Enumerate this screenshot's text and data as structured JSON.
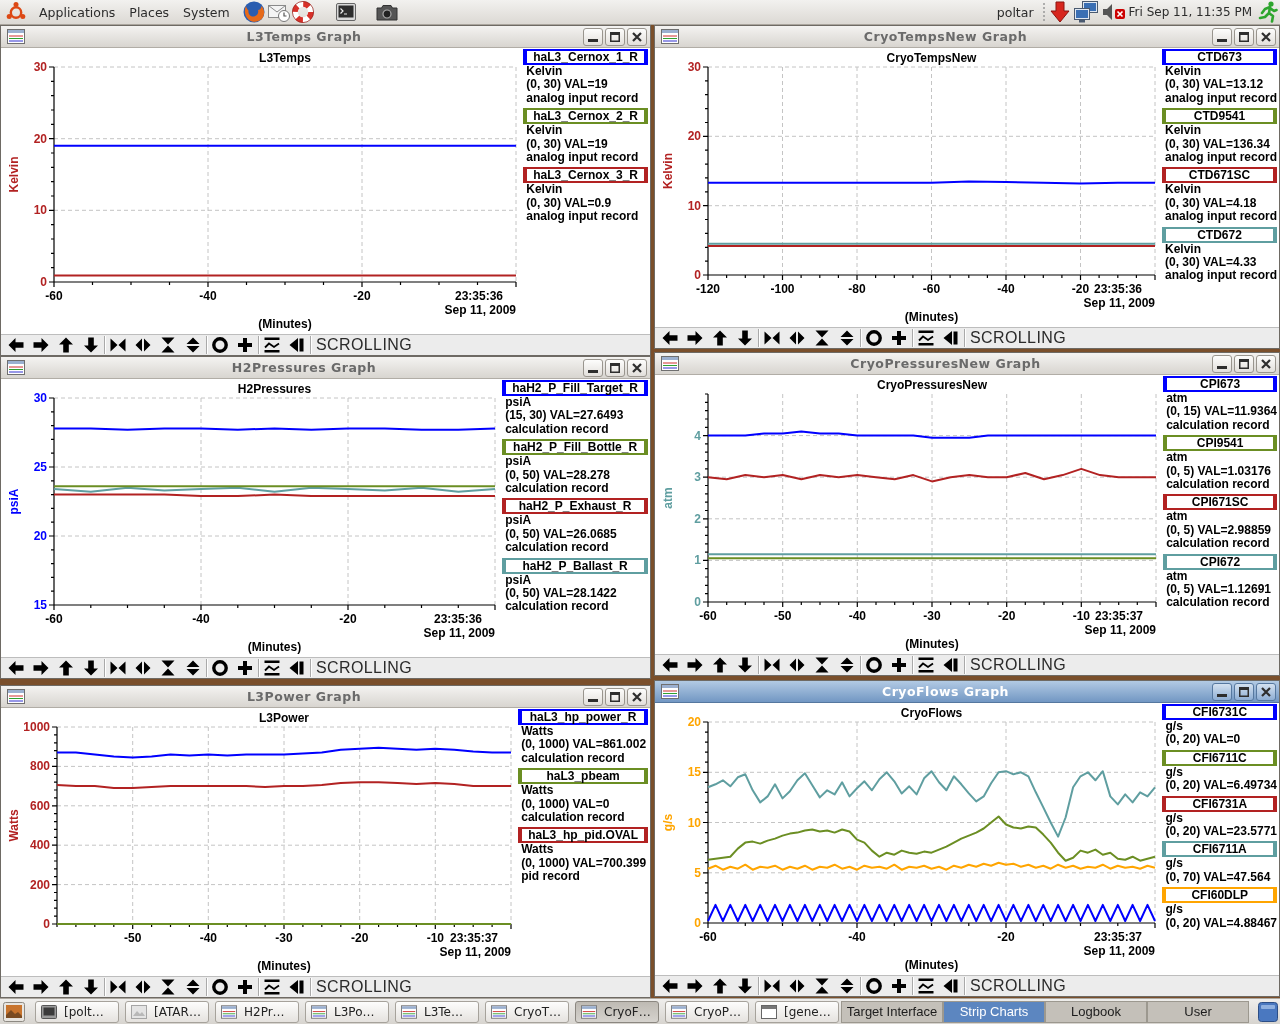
{
  "top_panel": {
    "menus": [
      "Applications",
      "Places",
      "System"
    ],
    "user": "poltar",
    "clock": "Fri Sep 11, 11:35 PM"
  },
  "windows": [
    {
      "title": "L3Temps Graph",
      "active": false,
      "graph": {
        "chart_data": {
          "type": "line",
          "title": "L3Temps",
          "xlabel": "(Minutes)",
          "ylabel": "Kelvin",
          "x": [
            -60,
            -50,
            -40,
            -30,
            -20,
            -10,
            0
          ],
          "series": [
            {
              "color": "#0000ff",
              "values": [
                19,
                19,
                19,
                19,
                19,
                19,
                19
              ]
            },
            {
              "color": "#b22222",
              "values": [
                0.9,
                0.9,
                0.9,
                0.9,
                0.9,
                0.9,
                0.9
              ]
            }
          ],
          "xlim": [
            -60,
            0
          ],
          "ylim": [
            0,
            30
          ],
          "xticks": [
            -60,
            -40,
            -20
          ],
          "yticks": [
            0,
            10,
            20,
            30
          ],
          "grid": true
        },
        "y_axis": {
          "color": "#b22222"
        },
        "time": "23:35:36",
        "date": "Sep 11, 2009"
      },
      "legend": [
        {
          "name": "haL3_Cernox_1_R",
          "color": "#0000ff",
          "units": "Kelvin",
          "info": "(0, 30) VAL=19",
          "record": "analog input record"
        },
        {
          "name": "haL3_Cernox_2_R",
          "color": "#6b8e23",
          "units": "Kelvin",
          "info": "(0, 30) VAL=19",
          "record": "analog input record"
        },
        {
          "name": "haL3_Cernox_3_R",
          "color": "#b22222",
          "units": "Kelvin",
          "info": "(0, 30) VAL=0.9",
          "record": "analog input record"
        }
      ],
      "status": "SCROLLING"
    },
    {
      "title": "CryoTempsNew Graph",
      "active": false,
      "graph": {
        "chart_data": {
          "type": "line",
          "title": "CryoTempsNew",
          "xlabel": "(Minutes)",
          "ylabel": "Kelvin",
          "x": [
            -120,
            -110,
            -100,
            -90,
            -80,
            -70,
            -60,
            -50,
            -40,
            -30,
            -20,
            -10,
            0
          ],
          "series": [
            {
              "color": "#0000ff",
              "values": [
                13.3,
                13.3,
                13.3,
                13.3,
                13.3,
                13.3,
                13.3,
                13.5,
                13.4,
                13.3,
                13.2,
                13.3,
                13.3
              ]
            },
            {
              "color": "#b22222",
              "values": [
                4.2,
                4.2,
                4.2,
                4.2,
                4.2,
                4.2,
                4.2,
                4.2,
                4.2,
                4.2,
                4.2,
                4.2,
                4.2
              ]
            },
            {
              "color": "#5f9ea0",
              "values": [
                4.5,
                4.5,
                4.5,
                4.5,
                4.5,
                4.5,
                4.5,
                4.5,
                4.5,
                4.5,
                4.5,
                4.5,
                4.5
              ]
            }
          ],
          "xlim": [
            -120,
            0
          ],
          "ylim": [
            0,
            30
          ],
          "xticks": [
            -120,
            -100,
            -80,
            -60,
            -40,
            -20
          ],
          "yticks": [
            0,
            10,
            20,
            30
          ],
          "grid": true
        },
        "y_axis": {
          "color": "#b22222"
        },
        "time": "23:35:36",
        "date": "Sep 11, 2009"
      },
      "legend": [
        {
          "name": "CTD673",
          "color": "#0000ff",
          "units": "Kelvin",
          "info": "(0, 30) VAL=13.12",
          "record": "analog input record"
        },
        {
          "name": "CTD9541",
          "color": "#6b8e23",
          "units": "Kelvin",
          "info": "(0, 30) VAL=136.34",
          "record": "analog input record"
        },
        {
          "name": "CTD671SC",
          "color": "#b22222",
          "units": "Kelvin",
          "info": "(0, 30) VAL=4.18",
          "record": "analog input record"
        },
        {
          "name": "CTD672",
          "color": "#5f9ea0",
          "units": "Kelvin",
          "info": "(0, 30) VAL=4.33",
          "record": "analog input record"
        }
      ],
      "status": "SCROLLING"
    },
    {
      "title": "H2Pressures Graph",
      "active": false,
      "graph": {
        "chart_data": {
          "type": "line",
          "title": "H2Pressures",
          "xlabel": "(Minutes)",
          "ylabel": "psiA",
          "x": [
            -60,
            -55,
            -50,
            -45,
            -40,
            -35,
            -30,
            -25,
            -20,
            -15,
            -10,
            -5,
            0
          ],
          "series": [
            {
              "color": "#0000ff",
              "values": [
                27.8,
                27.8,
                27.7,
                27.8,
                27.8,
                27.7,
                27.8,
                27.7,
                27.8,
                27.8,
                27.7,
                27.7,
                27.8
              ]
            },
            {
              "color": "#6b8e23",
              "values": [
                23.6,
                23.6,
                23.6,
                23.6,
                23.6,
                23.6,
                23.6,
                23.6,
                23.6,
                23.6,
                23.6,
                23.6,
                23.6
              ]
            },
            {
              "color": "#b22222",
              "values": [
                23.0,
                23.0,
                23.0,
                23.0,
                22.9,
                22.9,
                23.0,
                22.9,
                22.9,
                22.9,
                22.9,
                22.9,
                22.9
              ]
            },
            {
              "color": "#5f9ea0",
              "values": [
                23.4,
                23.2,
                23.5,
                23.3,
                23.4,
                23.5,
                23.2,
                23.5,
                23.4,
                23.3,
                23.5,
                23.2,
                23.4
              ]
            }
          ],
          "xlim": [
            -60,
            0
          ],
          "ylim": [
            15,
            30
          ],
          "xticks": [
            -60,
            -40,
            -20
          ],
          "yticks": [
            15,
            20,
            25,
            30
          ],
          "grid": true
        },
        "y_axis": {
          "color": "#0000ff"
        },
        "time": "23:35:36",
        "date": "Sep 11, 2009"
      },
      "legend": [
        {
          "name": "haH2_P_Fill_Target_R",
          "color": "#0000ff",
          "units": "psiA",
          "info": "(15, 30) VAL=27.6493",
          "record": "calculation record"
        },
        {
          "name": "haH2_P_Fill_Bottle_R",
          "color": "#6b8e23",
          "units": "psiA",
          "info": "(0, 50) VAL=28.278",
          "record": "calculation record"
        },
        {
          "name": "haH2_P_Exhaust_R",
          "color": "#b22222",
          "units": "psiA",
          "info": "(0, 50) VAL=26.0685",
          "record": "calculation record"
        },
        {
          "name": "haH2_P_Ballast_R",
          "color": "#5f9ea0",
          "units": "psiA",
          "info": "(0, 50) VAL=28.1422",
          "record": "calculation record"
        }
      ],
      "status": "SCROLLING"
    },
    {
      "title": "CryoPressuresNew Graph",
      "active": false,
      "graph": {
        "chart_data": {
          "type": "line",
          "title": "CryoPressuresNew",
          "xlabel": "(Minutes)",
          "ylabel": "atm",
          "x": [
            -60,
            -57.5,
            -55,
            -52.5,
            -50,
            -47.5,
            -45,
            -42.5,
            -40,
            -37.5,
            -35,
            -32.5,
            -30,
            -27.5,
            -25,
            -22.5,
            -20,
            -17.5,
            -15,
            -12.5,
            -10,
            -7.5,
            -5,
            -2.5,
            0
          ],
          "series": [
            {
              "color": "#0000ff",
              "values": [
                4.0,
                4.0,
                4.0,
                4.05,
                4.05,
                4.1,
                4.05,
                4.05,
                4.0,
                4.0,
                4.0,
                4.0,
                3.95,
                3.95,
                3.95,
                4.0,
                4.0,
                4.0,
                4.0,
                4.0,
                4.0,
                4.0,
                4.0,
                4.0,
                4.0
              ]
            },
            {
              "color": "#6b8e23",
              "values": [
                1.05,
                1.05,
                1.05,
                1.05,
                1.05,
                1.05,
                1.05,
                1.05,
                1.05,
                1.05,
                1.05,
                1.05,
                1.05,
                1.05,
                1.05,
                1.05,
                1.05,
                1.05,
                1.05,
                1.05,
                1.05,
                1.05,
                1.05,
                1.05,
                1.05
              ]
            },
            {
              "color": "#b22222",
              "values": [
                3.0,
                2.95,
                3.05,
                3.0,
                3.05,
                2.95,
                3.05,
                3.0,
                3.05,
                3.0,
                2.95,
                3.05,
                2.9,
                3.0,
                3.05,
                3.0,
                3.0,
                3.1,
                2.95,
                3.05,
                3.2,
                3.05,
                3.0,
                3.0,
                3.0
              ]
            },
            {
              "color": "#5f9ea0",
              "values": [
                1.15,
                1.15,
                1.15,
                1.15,
                1.15,
                1.15,
                1.15,
                1.15,
                1.15,
                1.15,
                1.15,
                1.15,
                1.15,
                1.15,
                1.15,
                1.15,
                1.15,
                1.15,
                1.15,
                1.15,
                1.15,
                1.15,
                1.15,
                1.15,
                1.15
              ]
            }
          ],
          "xlim": [
            -60,
            0
          ],
          "ylim": [
            0,
            5
          ],
          "xticks": [
            -60,
            -50,
            -40,
            -30,
            -20,
            -10
          ],
          "yticks": [
            0,
            1,
            2,
            3,
            4
          ],
          "grid": true
        },
        "y_axis": {
          "color": "#5f9ea0"
        },
        "time": "23:35:37",
        "date": "Sep 11, 2009"
      },
      "legend": [
        {
          "name": "CPI673",
          "color": "#0000ff",
          "units": "atm",
          "info": "(0, 15) VAL=11.9364",
          "record": "calculation record"
        },
        {
          "name": "CPI9541",
          "color": "#6b8e23",
          "units": "atm",
          "info": "(0, 5) VAL=1.03176",
          "record": "calculation record"
        },
        {
          "name": "CPI671SC",
          "color": "#b22222",
          "units": "atm",
          "info": "(0, 5) VAL=2.98859",
          "record": "calculation record"
        },
        {
          "name": "CPI672",
          "color": "#5f9ea0",
          "units": "atm",
          "info": "(0, 5) VAL=1.12691",
          "record": "calculation record"
        }
      ],
      "status": "SCROLLING"
    },
    {
      "title": "L3Power Graph",
      "active": false,
      "graph": {
        "chart_data": {
          "type": "line",
          "title": "L3Power",
          "xlabel": "(Minutes)",
          "ylabel": "Watts",
          "x": [
            -60,
            -57.5,
            -55,
            -52.5,
            -50,
            -47.5,
            -45,
            -42.5,
            -40,
            -37.5,
            -35,
            -32.5,
            -30,
            -27.5,
            -25,
            -22.5,
            -20,
            -17.5,
            -15,
            -12.5,
            -10,
            -7.5,
            -5,
            -2.5,
            0
          ],
          "series": [
            {
              "color": "#0000ff",
              "values": [
                870,
                870,
                860,
                850,
                845,
                850,
                860,
                855,
                860,
                855,
                860,
                860,
                860,
                865,
                870,
                885,
                890,
                895,
                890,
                885,
                890,
                885,
                875,
                870,
                870
              ]
            },
            {
              "color": "#6b8e23",
              "values": [
                0,
                0,
                0,
                0,
                0,
                0,
                0,
                0,
                0,
                0,
                0,
                0,
                0,
                0,
                0,
                0,
                0,
                0,
                0,
                0,
                0,
                0,
                0,
                0,
                0
              ]
            },
            {
              "color": "#b22222",
              "values": [
                705,
                700,
                700,
                690,
                690,
                695,
                700,
                700,
                700,
                700,
                700,
                695,
                700,
                700,
                705,
                715,
                720,
                720,
                715,
                710,
                715,
                710,
                700,
                700,
                700
              ]
            }
          ],
          "xlim": [
            -60,
            0
          ],
          "ylim": [
            0,
            1000
          ],
          "xticks": [
            -50,
            -40,
            -30,
            -20,
            -10
          ],
          "yticks": [
            0,
            200,
            400,
            600,
            800,
            1000
          ],
          "grid": true
        },
        "y_axis": {
          "color": "#b22222"
        },
        "time": "23:35:37",
        "date": "Sep 11, 2009"
      },
      "legend": [
        {
          "name": "haL3_hp_power_R",
          "color": "#0000ff",
          "units": "Watts",
          "info": "(0, 1000) VAL=861.002",
          "record": "calculation record"
        },
        {
          "name": "haL3_pbeam",
          "color": "#6b8e23",
          "units": "Watts",
          "info": "(0, 1000) VAL=0",
          "record": "calculation record"
        },
        {
          "name": "haL3_hp_pid.OVAL",
          "color": "#b22222",
          "units": "Watts",
          "info": "(0, 1000) VAL=700.399",
          "record": "pid record"
        }
      ],
      "status": "SCROLLING"
    },
    {
      "title": "CryoFlows Graph",
      "active": true,
      "graph": {
        "chart_data": {
          "type": "line",
          "title": "CryoFlows",
          "xlabel": "(Minutes)",
          "ylabel": "g/s",
          "x": [
            -60,
            -59,
            -58,
            -57,
            -56,
            -55,
            -54,
            -53,
            -52,
            -51,
            -50,
            -49,
            -48,
            -47,
            -46,
            -45,
            -44,
            -43,
            -42,
            -41,
            -40,
            -39,
            -38,
            -37,
            -36,
            -35,
            -34,
            -33,
            -32,
            -31,
            -30,
            -29,
            -28,
            -27,
            -26,
            -25,
            -24,
            -23,
            -22,
            -21,
            -20,
            -19,
            -18,
            -17,
            -16,
            -15,
            -14,
            -13,
            -12,
            -11,
            -10,
            -9,
            -8,
            -7,
            -6,
            -5,
            -4,
            -3,
            -2,
            -1,
            0
          ],
          "series": [
            {
              "color": "#0000ff",
              "values": [
                0.2,
                1.8,
                0.2,
                1.8,
                0.2,
                1.8,
                0.2,
                1.8,
                0.2,
                1.8,
                0.2,
                1.8,
                0.2,
                1.8,
                0.2,
                1.8,
                0.2,
                1.8,
                0.2,
                1.8,
                0.2,
                1.8,
                0.2,
                1.8,
                0.2,
                1.8,
                0.2,
                1.8,
                0.2,
                1.8,
                0.2,
                1.8,
                0.2,
                1.8,
                0.2,
                1.8,
                0.2,
                1.8,
                0.2,
                1.8,
                0.2,
                1.8,
                0.2,
                1.8,
                0.2,
                1.8,
                0.2,
                1.8,
                0.2,
                1.8,
                0.2,
                1.8,
                0.2,
                1.8,
                0.2,
                1.8,
                0.2,
                1.8,
                0.2,
                1.8,
                0.2
              ]
            },
            {
              "color": "#6b8e23",
              "values": [
                6.3,
                6.4,
                6.5,
                6.6,
                7.4,
                8.0,
                8.1,
                7.9,
                8.2,
                8.4,
                8.7,
                8.9,
                9.0,
                9.2,
                9.3,
                9.1,
                9.2,
                9.0,
                9.3,
                9.1,
                8.3,
                8.0,
                7.2,
                6.6,
                7.0,
                6.8,
                7.2,
                7.0,
                6.9,
                7.1,
                7.0,
                7.3,
                7.6,
                8.0,
                8.4,
                8.7,
                9.0,
                9.4,
                10.0,
                10.6,
                9.8,
                9.5,
                9.4,
                9.6,
                9.5,
                8.8,
                8.0,
                7.0,
                6.2,
                6.5,
                7.2,
                7.0,
                7.3,
                6.8,
                7.0,
                6.4,
                6.3,
                6.6,
                6.2,
                6.4,
                6.6
              ]
            },
            {
              "color": "#5f9ea0",
              "values": [
                13.5,
                13.8,
                14.2,
                13.6,
                14.5,
                14.8,
                13.2,
                12.0,
                12.6,
                13.8,
                12.4,
                13.1,
                14.2,
                14.9,
                13.7,
                12.5,
                13.2,
                12.8,
                14.0,
                12.6,
                13.4,
                14.1,
                13.2,
                14.3,
                15.0,
                14.1,
                12.9,
                13.6,
                12.8,
                14.4,
                15.1,
                14.0,
                13.2,
                14.6,
                13.8,
                12.9,
                12.1,
                12.6,
                13.9,
                15.0,
                15.1,
                14.8,
                15.0,
                14.6,
                13.0,
                11.5,
                10.0,
                8.6,
                10.5,
                13.5,
                14.6,
                15.0,
                14.2,
                15.1,
                12.6,
                11.8,
                12.8,
                12.0,
                13.0,
                12.6,
                13.5
              ]
            },
            {
              "color": "#ffa500",
              "values": [
                5.4,
                5.7,
                5.3,
                5.6,
                5.4,
                5.8,
                5.3,
                5.6,
                5.5,
                5.7,
                5.3,
                5.6,
                5.4,
                5.7,
                5.3,
                5.6,
                5.5,
                5.8,
                5.4,
                5.6,
                5.3,
                5.7,
                5.5,
                5.6,
                5.4,
                5.8,
                5.3,
                5.6,
                5.5,
                5.7,
                5.4,
                5.6,
                5.3,
                5.7,
                5.5,
                5.8,
                5.6,
                5.9,
                5.7,
                6.0,
                5.8,
                5.9,
                5.6,
                5.8,
                5.5,
                5.7,
                5.4,
                5.8,
                5.5,
                5.7,
                5.4,
                5.6,
                5.5,
                5.8,
                5.4,
                5.7,
                5.5,
                5.6,
                5.4,
                5.7,
                5.5
              ]
            }
          ],
          "xlim": [
            -60,
            0
          ],
          "ylim": [
            0,
            20
          ],
          "xticks": [
            -60,
            -40,
            -20
          ],
          "yticks": [
            0,
            5,
            10,
            15,
            20
          ],
          "grid": true
        },
        "y_axis": {
          "color": "#ffa500"
        },
        "time": "23:35:37",
        "date": "Sep 11, 2009"
      },
      "legend": [
        {
          "name": "CFI6731C",
          "color": "#0000ff",
          "units": "g/s",
          "info": "(0, 20) VAL=0"
        },
        {
          "name": "CFI6711C",
          "color": "#6b8e23",
          "units": "g/s",
          "info": "(0, 20) VAL=6.49734"
        },
        {
          "name": "CFI6731A",
          "color": "#b22222",
          "units": "g/s",
          "info": "(0, 20) VAL=23.5771"
        },
        {
          "name": "CFI6711A",
          "color": "#5f9ea0",
          "units": "g/s",
          "info": "(0, 70) VAL=47.564"
        },
        {
          "name": "CFI60DLP",
          "color": "#ffa500",
          "units": "g/s",
          "info": "(0, 20) VAL=4.88467"
        }
      ],
      "status": "SCROLLING"
    }
  ],
  "taskbar": {
    "tasks": [
      {
        "label": "[polt…",
        "kind": "terminal",
        "selected": false
      },
      {
        "label": "[ATAR…",
        "kind": "picture",
        "selected": false
      },
      {
        "label": "H2Pr…",
        "kind": "chart",
        "selected": false
      },
      {
        "label": "L3Po…",
        "kind": "chart",
        "selected": false
      },
      {
        "label": "L3Te…",
        "kind": "chart",
        "selected": false
      },
      {
        "label": "CryoT…",
        "kind": "chart",
        "selected": false
      },
      {
        "label": "CryoF…",
        "kind": "chart",
        "selected": true
      },
      {
        "label": "CryoP…",
        "kind": "chart",
        "selected": false
      },
      {
        "label": "[gene…",
        "kind": "window",
        "selected": false
      }
    ],
    "workspaces": [
      {
        "label": "Target Interface",
        "selected": false
      },
      {
        "label": "Strip Charts",
        "selected": true
      },
      {
        "label": "Logbook",
        "selected": false
      },
      {
        "label": "User",
        "selected": false
      }
    ]
  }
}
